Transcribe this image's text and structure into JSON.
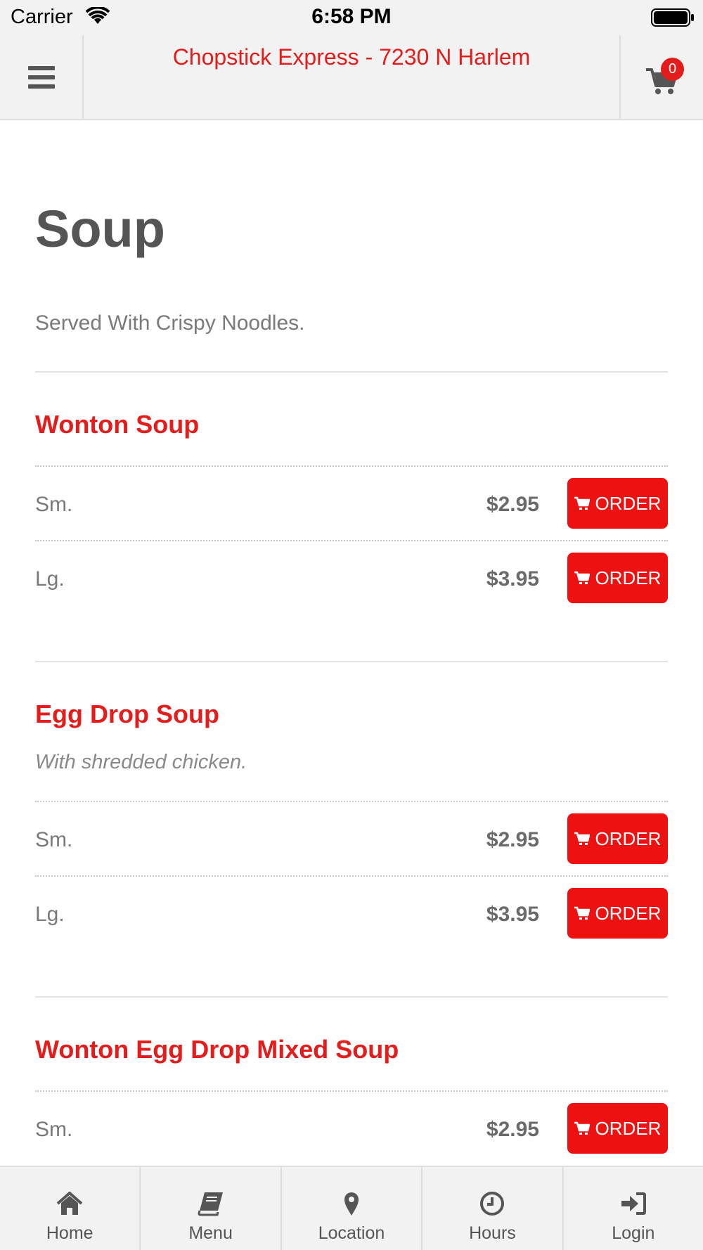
{
  "status_bar": {
    "carrier": "Carrier",
    "time": "6:58 PM"
  },
  "header": {
    "title": "Chopstick Express - 7230 N Harlem",
    "cart_count": "0"
  },
  "category": {
    "title": "Soup",
    "description": "Served With Crispy Noodles."
  },
  "items": [
    {
      "name": "Wonton Soup",
      "description": "",
      "prices": [
        {
          "size": "Sm.",
          "price": "$2.95",
          "button": "ORDER"
        },
        {
          "size": "Lg.",
          "price": "$3.95",
          "button": "ORDER"
        }
      ]
    },
    {
      "name": "Egg Drop Soup",
      "description": "With shredded chicken.",
      "prices": [
        {
          "size": "Sm.",
          "price": "$2.95",
          "button": "ORDER"
        },
        {
          "size": "Lg.",
          "price": "$3.95",
          "button": "ORDER"
        }
      ]
    },
    {
      "name": "Wonton Egg Drop Mixed Soup",
      "description": "",
      "prices": [
        {
          "size": "Sm.",
          "price": "$2.95",
          "button": "ORDER"
        }
      ]
    }
  ],
  "tabbar": [
    {
      "label": "Home",
      "icon": "home-icon"
    },
    {
      "label": "Menu",
      "icon": "book-icon"
    },
    {
      "label": "Location",
      "icon": "map-pin-icon"
    },
    {
      "label": "Hours",
      "icon": "clock-icon"
    },
    {
      "label": "Login",
      "icon": "sign-in-icon"
    }
  ],
  "colors": {
    "accent": "#e41c1c",
    "button": "#ee1111",
    "bar_bg": "#f2f2f2"
  }
}
